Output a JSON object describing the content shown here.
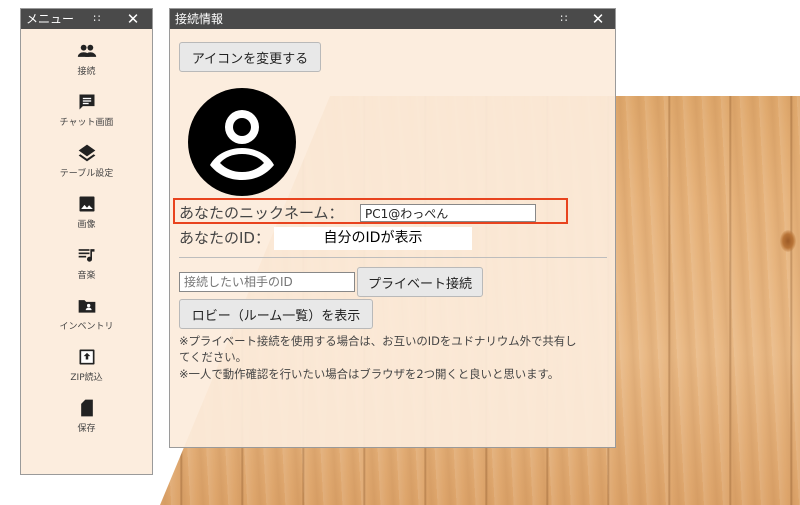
{
  "menu": {
    "title": "メニュー",
    "items": [
      {
        "label": "接続",
        "icon": "people-icon"
      },
      {
        "label": "チャット画面",
        "icon": "chat-icon"
      },
      {
        "label": "テーブル設定",
        "icon": "layers-icon"
      },
      {
        "label": "画像",
        "icon": "image-icon"
      },
      {
        "label": "音楽",
        "icon": "music-queue-icon"
      },
      {
        "label": "インベントリ",
        "icon": "folder-person-icon"
      },
      {
        "label": "ZIP読込",
        "icon": "upload-box-icon"
      },
      {
        "label": "保存",
        "icon": "sd-card-icon"
      }
    ]
  },
  "connection": {
    "title": "接続情報",
    "change_icon_label": "アイコンを変更する",
    "nickname_label": "あなたのニックネーム：",
    "nickname_value": "PC1@わっぺん",
    "id_label": "あなたのID：",
    "id_value": "自分のIDが表示",
    "peer_id_placeholder": "接続したい相手のID",
    "private_connect_label": "プライベート接続",
    "lobby_label": "ロビー（ルーム一覧）を表示",
    "note1": "※プライベート接続を使用する場合は、お互いのIDをユドナリウム外で共有し",
    "note1b": "てください。",
    "note2": "※一人で動作確認を行いたい場合はブラウザを2つ開くと良いと思います。"
  },
  "colors": {
    "titlebar": "#4a4a4a",
    "panel_bg": "#fcecdc",
    "highlight": "#e8431e",
    "icon": "#222222"
  }
}
